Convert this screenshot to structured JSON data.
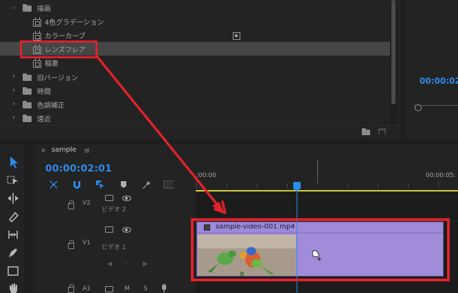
{
  "effects_panel": {
    "items": [
      {
        "label": "描画",
        "kind": "folder",
        "expanded": true
      },
      {
        "label": "4色グラデーション",
        "kind": "effect"
      },
      {
        "label": "カラーカーブ",
        "kind": "effect"
      },
      {
        "label": "レンズフレア",
        "kind": "effect",
        "selected": true
      },
      {
        "label": "稲妻",
        "kind": "effect"
      },
      {
        "label": "旧バージョン",
        "kind": "folder"
      },
      {
        "label": "時間",
        "kind": "folder"
      },
      {
        "label": "色調補正",
        "kind": "folder"
      },
      {
        "label": "遠近",
        "kind": "folder"
      }
    ]
  },
  "monitor": {
    "timecode": "00:00:02"
  },
  "timeline": {
    "sequence_name": "sample",
    "timecode": "00:00:02:01",
    "ruler_labels": [
      ":00:00",
      "00:00:05:"
    ],
    "tracks": [
      {
        "id": "V2",
        "name": "ビデオ 2"
      },
      {
        "id": "V1",
        "name": "ビデオ 1"
      },
      {
        "id": "A1",
        "mute": "M",
        "solo": "S"
      }
    ],
    "clip": {
      "name": "sample-video-001.mp4",
      "color": "#a08cd8"
    }
  },
  "tools": [
    "selection-tool",
    "track-select-tool",
    "ripple-edit-tool",
    "razor-tool",
    "slip-tool",
    "pen-tool",
    "rectangle-tool",
    "hand-tool"
  ],
  "annotation": {
    "color": "#e0222a"
  }
}
